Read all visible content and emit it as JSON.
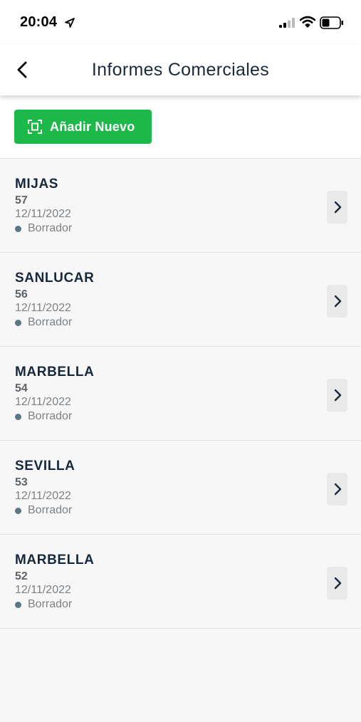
{
  "status_bar": {
    "time": "20:04"
  },
  "header": {
    "title": "Informes Comerciales"
  },
  "toolbar": {
    "add_label": "Añadir Nuevo"
  },
  "items": [
    {
      "name": "MIJAS",
      "number": "57",
      "date": "12/11/2022",
      "status": "Borrador"
    },
    {
      "name": "SANLUCAR",
      "number": "56",
      "date": "12/11/2022",
      "status": "Borrador"
    },
    {
      "name": "MARBELLA",
      "number": "54",
      "date": "12/11/2022",
      "status": "Borrador"
    },
    {
      "name": "SEVILLA",
      "number": "53",
      "date": "12/11/2022",
      "status": "Borrador"
    },
    {
      "name": "MARBELLA",
      "number": "52",
      "date": "12/11/2022",
      "status": "Borrador"
    }
  ],
  "colors": {
    "accent": "#1db84a",
    "status_dot": "#5a7684",
    "title_text": "#16283b"
  },
  "icons": [
    "location-arrow-icon",
    "signal-icon",
    "wifi-icon",
    "battery-icon",
    "back-chevron-icon",
    "scan-icon",
    "chevron-right-icon"
  ]
}
